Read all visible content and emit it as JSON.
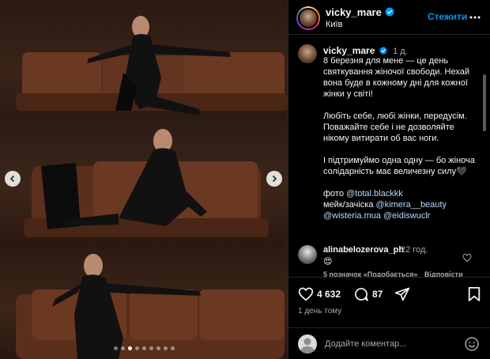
{
  "header": {
    "username": "vicky_mare",
    "location": "Київ",
    "follow_label": "Стежити"
  },
  "caption": {
    "username": "vicky_mare",
    "time": "1 д.",
    "para1": "8 березня для мене — це день святкування жіночої свободи. Нехай вона буде в кожному дні для кожної жінки у світі!",
    "para2": "Любіть себе, любі жінки, передусім. Поважайте себе і не дозволяйте нікому витирати об вас ноги.",
    "para3": "І підтримуймо одна одну — бо жіноча солідарність має величезну силу🖤",
    "credit_photo_label": "фото",
    "credit_photo_mention": "@total.blackkk",
    "credit_makeup_label": "мейк/зачіска",
    "credit_makeup_mention": "@kimera__beauty",
    "credit_mention3": "@wisteria.mua",
    "credit_mention4": "@eidiswuclr"
  },
  "comment": {
    "username": "alinabelozerova_ph",
    "time": "22 год.",
    "text": "😍",
    "likes": "5 позначок «Подобається»",
    "reply": "Відповісти"
  },
  "actions": {
    "like_count": "4 632",
    "comment_count": "87",
    "posted": "1 день тому"
  },
  "comment_bar": {
    "placeholder": "Додайте коментар..."
  },
  "carousel": {
    "slide_count": 9,
    "active_index": 2
  },
  "colors": {
    "accent": "#0095f6",
    "background": "#000000",
    "secondary_text": "#a8a8a8"
  }
}
